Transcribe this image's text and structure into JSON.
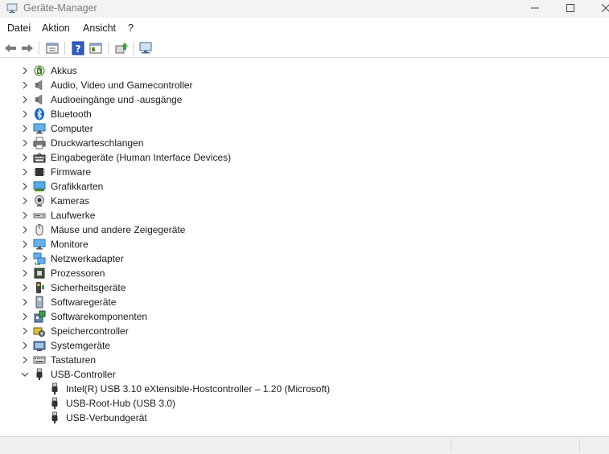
{
  "window": {
    "title": "Geräte-Manager",
    "app_icon": "device-manager-icon",
    "controls": [
      "minimize-icon",
      "maximize-icon",
      "close-icon"
    ]
  },
  "menu": [
    "Datei",
    "Aktion",
    "Ansicht",
    "?"
  ],
  "toolbar": [
    "back-arrow-icon",
    "forward-arrow-icon",
    "properties-icon",
    "help-icon",
    "view-icon",
    "update-driver-icon",
    "monitor-scan-icon"
  ],
  "tree": {
    "categories": [
      {
        "label": "Akkus",
        "icon": "battery-icon",
        "expanded": false
      },
      {
        "label": "Audio, Video und Gamecontroller",
        "icon": "speaker-icon",
        "expanded": false
      },
      {
        "label": "Audioeingänge und -ausgänge",
        "icon": "speaker-icon",
        "expanded": false
      },
      {
        "label": "Bluetooth",
        "icon": "bluetooth-icon",
        "expanded": false
      },
      {
        "label": "Computer",
        "icon": "computer-icon",
        "expanded": false
      },
      {
        "label": "Druckwarteschlangen",
        "icon": "printer-icon",
        "expanded": false
      },
      {
        "label": "Eingabegeräte (Human Interface Devices)",
        "icon": "keyboard-hid-icon",
        "expanded": false
      },
      {
        "label": "Firmware",
        "icon": "chip-icon",
        "expanded": false
      },
      {
        "label": "Grafikkarten",
        "icon": "display-adapter-icon",
        "expanded": false
      },
      {
        "label": "Kameras",
        "icon": "webcam-icon",
        "expanded": false
      },
      {
        "label": "Laufwerke",
        "icon": "drive-icon",
        "expanded": false
      },
      {
        "label": "Mäuse und andere Zeigegeräte",
        "icon": "mouse-icon",
        "expanded": false
      },
      {
        "label": "Monitore",
        "icon": "monitor-icon",
        "expanded": false
      },
      {
        "label": "Netzwerkadapter",
        "icon": "network-icon",
        "expanded": false
      },
      {
        "label": "Prozessoren",
        "icon": "processor-icon",
        "expanded": false
      },
      {
        "label": "Sicherheitsgeräte",
        "icon": "security-key-icon",
        "expanded": false
      },
      {
        "label": "Softwaregeräte",
        "icon": "software-device-icon",
        "expanded": false
      },
      {
        "label": "Softwarekomponenten",
        "icon": "software-component-icon",
        "expanded": false
      },
      {
        "label": "Speichercontroller",
        "icon": "storage-controller-icon",
        "expanded": false
      },
      {
        "label": "Systemgeräte",
        "icon": "system-folder-icon",
        "expanded": false
      },
      {
        "label": "Tastaturen",
        "icon": "keyboard-icon",
        "expanded": false
      },
      {
        "label": "USB-Controller",
        "icon": "usb-plug-icon",
        "expanded": true
      }
    ],
    "usb_children": [
      {
        "label": "Intel(R) USB 3.10 eXtensible-Hostcontroller – 1.20 (Microsoft)",
        "icon": "usb-plug-icon"
      },
      {
        "label": "USB-Root-Hub (USB 3.0)",
        "icon": "usb-plug-icon"
      },
      {
        "label": "USB-Verbundgerät",
        "icon": "usb-plug-icon"
      }
    ]
  }
}
